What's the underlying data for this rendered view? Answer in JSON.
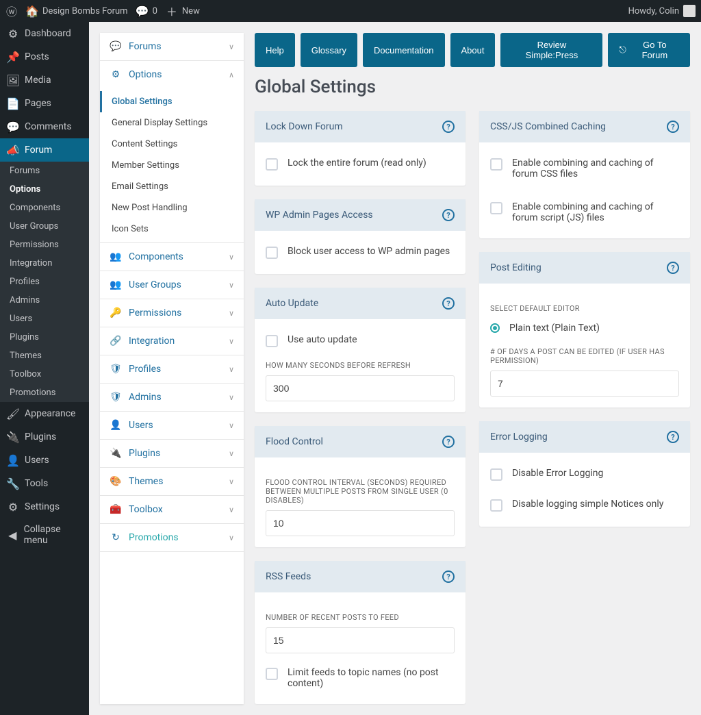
{
  "adminbar": {
    "site_name": "Design Bombs Forum",
    "comments": "0",
    "new": "New",
    "howdy": "Howdy, Colin"
  },
  "wp_menu": [
    {
      "label": "Dashboard",
      "icon": "⚙"
    },
    {
      "label": "Posts",
      "icon": "📌"
    },
    {
      "label": "Media",
      "icon": "🖼"
    },
    {
      "label": "Pages",
      "icon": "📄"
    },
    {
      "label": "Comments",
      "icon": "💬"
    },
    {
      "label": "Forum",
      "icon": "📣",
      "active": true
    }
  ],
  "forum_submenu": [
    "Forums",
    "Options",
    "Components",
    "User Groups",
    "Permissions",
    "Integration",
    "Profiles",
    "Admins",
    "Users",
    "Plugins",
    "Themes",
    "Toolbox",
    "Promotions"
  ],
  "forum_submenu_active": "Options",
  "wp_menu_lower": [
    {
      "label": "Appearance",
      "icon": "🖌"
    },
    {
      "label": "Plugins",
      "icon": "🔌"
    },
    {
      "label": "Users",
      "icon": "👤"
    },
    {
      "label": "Tools",
      "icon": "🔧"
    },
    {
      "label": "Settings",
      "icon": "⚙"
    },
    {
      "label": "Collapse menu",
      "icon": "◀"
    }
  ],
  "forum_sidebar": [
    {
      "label": "Forums",
      "icon": "💬",
      "expanded": false
    },
    {
      "label": "Options",
      "icon": "⚙",
      "expanded": true,
      "items": [
        "Global Settings",
        "General Display Settings",
        "Content Settings",
        "Member Settings",
        "Email Settings",
        "New Post Handling",
        "Icon Sets"
      ],
      "active": "Global Settings"
    },
    {
      "label": "Components",
      "icon": "👥",
      "expanded": false
    },
    {
      "label": "User Groups",
      "icon": "👥",
      "expanded": false
    },
    {
      "label": "Permissions",
      "icon": "🔑",
      "expanded": false
    },
    {
      "label": "Integration",
      "icon": "🔗",
      "expanded": false
    },
    {
      "label": "Profiles",
      "icon": "🛡",
      "expanded": false
    },
    {
      "label": "Admins",
      "icon": "🛡",
      "expanded": false
    },
    {
      "label": "Users",
      "icon": "👤",
      "expanded": false
    },
    {
      "label": "Plugins",
      "icon": "🔌",
      "expanded": false
    },
    {
      "label": "Themes",
      "icon": "🎨",
      "expanded": false
    },
    {
      "label": "Toolbox",
      "icon": "🧰",
      "expanded": false
    },
    {
      "label": "Promotions",
      "icon": "↻",
      "expanded": false,
      "promo": true
    }
  ],
  "topbar": [
    "Help",
    "Glossary",
    "Documentation",
    "About",
    "Review Simple:Press"
  ],
  "topbar_forum": "Go To Forum",
  "page_title": "Global Settings",
  "cards": {
    "lockdown": {
      "title": "Lock Down Forum",
      "opt1": "Lock the entire forum (read only)"
    },
    "wpadmin": {
      "title": "WP Admin Pages Access",
      "opt1": "Block user access to WP admin pages"
    },
    "autoupdate": {
      "title": "Auto Update",
      "opt1": "Use auto update",
      "field_label": "HOW MANY SECONDS BEFORE REFRESH",
      "value": "300"
    },
    "flood": {
      "title": "Flood Control",
      "field_label": "FLOOD CONTROL INTERVAL (SECONDS) REQUIRED BETWEEN MULTIPLE POSTS FROM SINGLE USER (0 DISABLES)",
      "value": "10"
    },
    "rss": {
      "title": "RSS Feeds",
      "field_label": "NUMBER OF RECENT POSTS TO FEED",
      "value": "15",
      "opt1": "Limit feeds to topic names (no post content)"
    },
    "cssjs": {
      "title": "CSS/JS Combined Caching",
      "opt1": "Enable combining and caching of forum CSS files",
      "opt2": "Enable combining and caching of forum script (JS) files"
    },
    "postedit": {
      "title": "Post Editing",
      "sub1": "SELECT DEFAULT EDITOR",
      "radio1": "Plain text (Plain Text)",
      "sub2": "# OF DAYS A POST CAN BE EDITED (IF USER HAS PERMISSION)",
      "value": "7"
    },
    "errorlog": {
      "title": "Error Logging",
      "opt1": "Disable Error Logging",
      "opt2": "Disable logging simple Notices only"
    }
  }
}
